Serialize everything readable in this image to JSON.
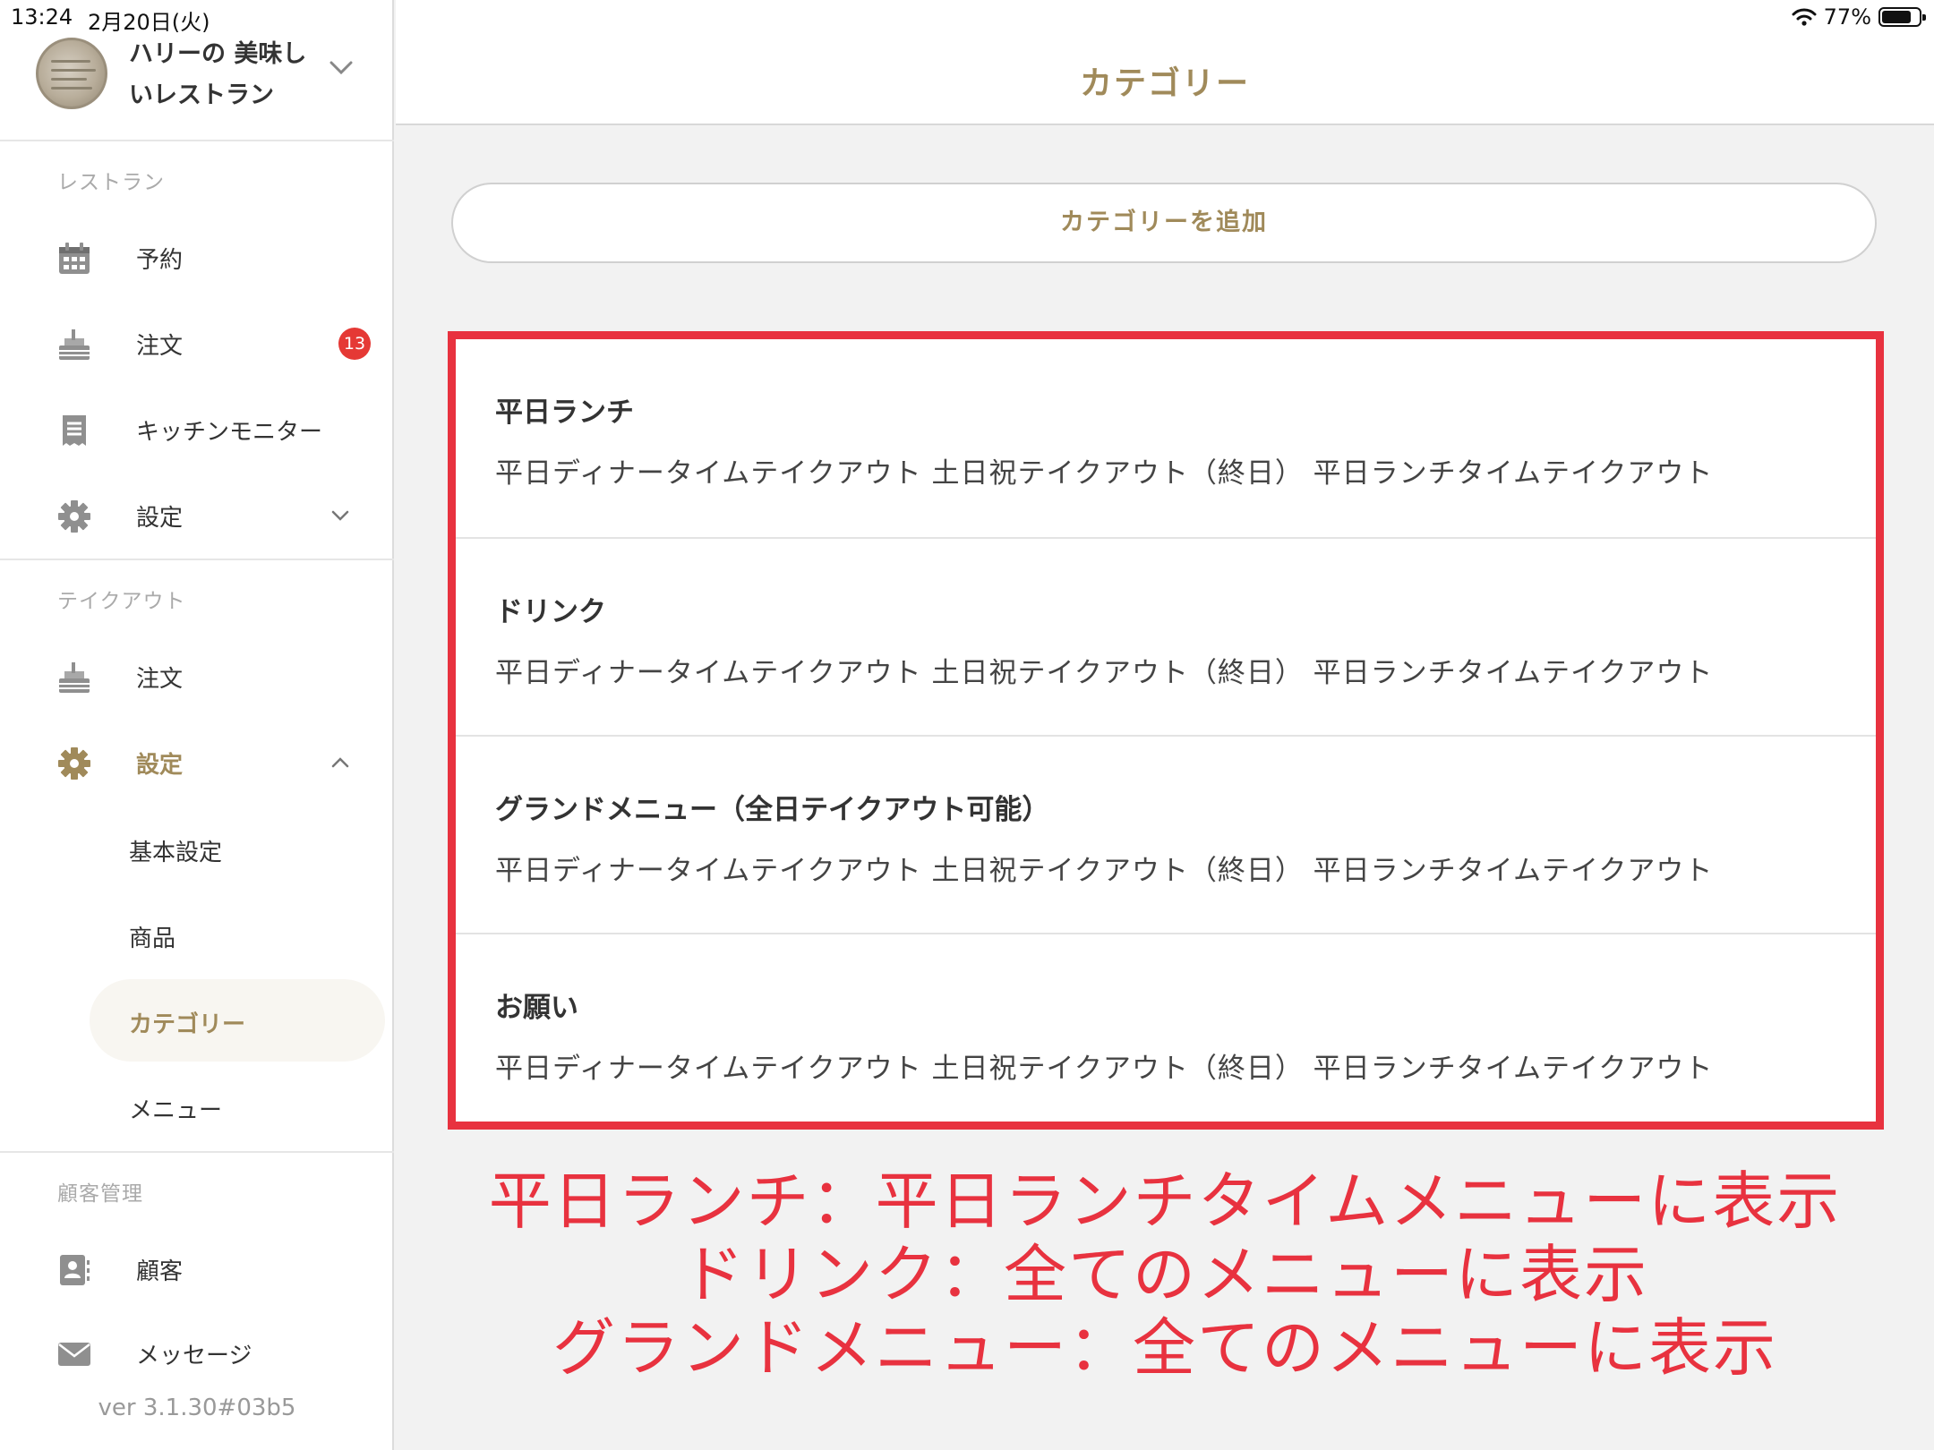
{
  "status_bar": {
    "time": "13:24",
    "date": "2月20日(火)",
    "battery": "77%"
  },
  "account": {
    "name_line1": "ハリーの 美味し",
    "name_line2": "いレストラン"
  },
  "sidebar": {
    "sections": {
      "restaurant": "レストラン",
      "takeout": "テイクアウト",
      "customers": "顧客管理"
    },
    "items": {
      "reservation": "予約",
      "orders": "注文",
      "orders_badge": "13",
      "kitchen_monitor": "キッチンモニター",
      "settings": "設定",
      "takeout_orders": "注文",
      "takeout_settings": "設定",
      "basic_settings": "基本設定",
      "products": "商品",
      "categories": "カテゴリー",
      "menu": "メニュー",
      "customers": "顧客",
      "messages": "メッセージ"
    },
    "version": "ver 3.1.30#03b5"
  },
  "header": {
    "title": "カテゴリー"
  },
  "add_category_label": "カテゴリーを追加",
  "categories": [
    {
      "name": "平日ランチ",
      "menus": "平日ディナータイムテイクアウト 土日祝テイクアウト（終日） 平日ランチタイムテイクアウト"
    },
    {
      "name": "ドリンク",
      "menus": "平日ディナータイムテイクアウト 土日祝テイクアウト（終日） 平日ランチタイムテイクアウト"
    },
    {
      "name": "グランドメニュー（全日テイクアウト可能）",
      "menus": "平日ディナータイムテイクアウト 土日祝テイクアウト（終日） 平日ランチタイムテイクアウト"
    },
    {
      "name": "お願い",
      "menus": "平日ディナータイムテイクアウト 土日祝テイクアウト（終日） 平日ランチタイムテイクアウト"
    }
  ],
  "annotations": [
    "平日ランチ：平日ランチタイムメニューに表示",
    "ドリンク：全てのメニューに表示",
    "グランドメニュー：全てのメニューに表示"
  ],
  "colors": {
    "accent": "#a08a5a",
    "highlight": "#e8323f",
    "badge": "#e53935"
  }
}
